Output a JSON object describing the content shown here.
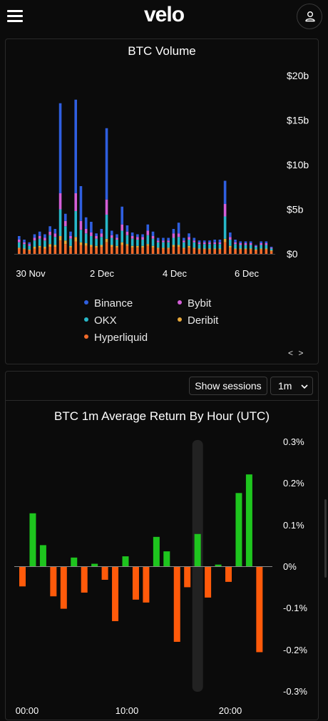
{
  "app": {
    "logo": "velo"
  },
  "header": {
    "menu_icon": "hamburger-menu-icon",
    "user_icon": "user-icon"
  },
  "volume_chart": {
    "chart_data": {
      "type": "bar",
      "title": "BTC Volume",
      "stacked": true,
      "y_ticks": [
        "$20b",
        "$15b",
        "$10b",
        "$5b",
        "$0"
      ],
      "x_ticks": [
        "30 Nov",
        "2 Dec",
        "4 Dec",
        "6 Dec"
      ],
      "ylim": [
        0,
        20
      ],
      "unit": "billions USD",
      "colors": {
        "Binance": "#2f5fe0",
        "Bybit": "#d45fd8",
        "OKX": "#27b8c9",
        "Deribit": "#e8a83a",
        "Hyperliquid": "#f06a2a"
      },
      "series": [
        {
          "name": "Binance",
          "values": [
            0.4,
            0.3,
            0.2,
            0.4,
            0.5,
            0.4,
            0.6,
            0.5,
            10.1,
            0.8,
            0.5,
            10.5,
            3.9,
            1.3,
            1.2,
            0.3,
            0.5,
            8.0,
            0.5,
            0.4,
            2.0,
            0.7,
            0.4,
            0.3,
            0.3,
            0.7,
            0.5,
            0.3,
            0.3,
            0.3,
            0.5,
            1.2,
            0.3,
            0.4,
            0.3,
            0.2,
            0.2,
            0.2,
            0.3,
            0.3,
            2.6,
            0.5,
            0.3,
            0.2,
            0.2,
            0.2,
            0.1,
            0.2,
            0.2,
            0.1
          ]
        },
        {
          "name": "Bybit",
          "values": [
            0.3,
            0.2,
            0.2,
            0.3,
            0.3,
            0.3,
            0.4,
            0.4,
            1.8,
            0.6,
            0.3,
            2.0,
            1.0,
            0.5,
            0.4,
            0.3,
            0.4,
            1.7,
            0.3,
            0.2,
            0.7,
            0.4,
            0.3,
            0.3,
            0.3,
            0.5,
            0.3,
            0.2,
            0.2,
            0.2,
            0.5,
            0.4,
            0.2,
            0.3,
            0.2,
            0.2,
            0.2,
            0.2,
            0.2,
            0.2,
            1.4,
            0.3,
            0.2,
            0.2,
            0.2,
            0.2,
            0.1,
            0.2,
            0.2,
            0.1
          ]
        },
        {
          "name": "OKX",
          "values": [
            0.6,
            0.5,
            0.4,
            0.7,
            0.8,
            0.7,
            1.0,
            0.9,
            3.0,
            1.6,
            0.8,
            2.9,
            1.4,
            1.1,
            1.0,
            0.8,
            0.9,
            2.7,
            0.8,
            0.7,
            1.3,
            1.0,
            0.8,
            0.7,
            0.7,
            1.0,
            0.8,
            0.6,
            0.6,
            0.6,
            0.8,
            0.9,
            0.6,
            0.7,
            0.6,
            0.5,
            0.5,
            0.5,
            0.5,
            0.5,
            2.5,
            0.7,
            0.5,
            0.4,
            0.4,
            0.4,
            0.3,
            0.4,
            0.4,
            0.2
          ]
        },
        {
          "name": "Deribit",
          "values": [
            0.1,
            0.1,
            0.1,
            0.2,
            0.2,
            0.2,
            0.3,
            0.2,
            0.5,
            0.4,
            0.2,
            0.5,
            0.3,
            0.3,
            0.2,
            0.2,
            0.2,
            0.4,
            0.2,
            0.2,
            0.3,
            0.2,
            0.2,
            0.2,
            0.2,
            0.2,
            0.2,
            0.1,
            0.1,
            0.1,
            0.2,
            0.2,
            0.1,
            0.2,
            0.1,
            0.1,
            0.1,
            0.1,
            0.1,
            0.1,
            0.4,
            0.2,
            0.1,
            0.1,
            0.1,
            0.1,
            0.1,
            0.1,
            0.1,
            0.1
          ]
        },
        {
          "name": "Hyperliquid",
          "values": [
            0.6,
            0.5,
            0.4,
            0.6,
            0.7,
            0.6,
            0.8,
            0.8,
            1.5,
            1.1,
            0.7,
            1.4,
            1.0,
            0.9,
            0.8,
            0.7,
            0.8,
            1.3,
            0.8,
            0.7,
            1.0,
            0.9,
            0.7,
            0.7,
            0.7,
            0.9,
            0.7,
            0.6,
            0.6,
            0.6,
            0.8,
            0.8,
            0.6,
            0.7,
            0.6,
            0.5,
            0.5,
            0.5,
            0.5,
            0.5,
            1.3,
            0.7,
            0.5,
            0.5,
            0.5,
            0.5,
            0.4,
            0.5,
            0.5,
            0.3
          ]
        }
      ],
      "legend": [
        "Binance",
        "Bybit",
        "OKX",
        "Deribit",
        "Hyperliquid"
      ]
    },
    "nav_arrows": "< >"
  },
  "returns_chart": {
    "controls": {
      "sessions_label": "Show sessions",
      "interval_label": "1m",
      "chevron_icon": "chevron-down-icon"
    },
    "chart_data": {
      "type": "bar",
      "title": "BTC 1m Average Return By Hour (UTC)",
      "y_ticks": [
        "0.3%",
        "0.2%",
        "0.1%",
        "0%",
        "-0.1%",
        "-0.2%",
        "-0.3%"
      ],
      "x_ticks": [
        "00:00",
        "10:00",
        "20:00"
      ],
      "ylim": [
        -0.3,
        0.3
      ],
      "unit": "percent",
      "positive_color": "#1ec51e",
      "negative_color": "#ff5a0a",
      "highlight_hour": 17,
      "series": [
        {
          "values": [
            -0.047,
            0.128,
            0.051,
            -0.071,
            -0.101,
            0.021,
            -0.062,
            0.006,
            -0.031,
            -0.131,
            0.024,
            -0.079,
            -0.086,
            0.071,
            0.036,
            -0.181,
            -0.049,
            0.078,
            -0.074,
            0.004,
            -0.036,
            0.177,
            0.222,
            -0.206
          ]
        }
      ]
    }
  }
}
